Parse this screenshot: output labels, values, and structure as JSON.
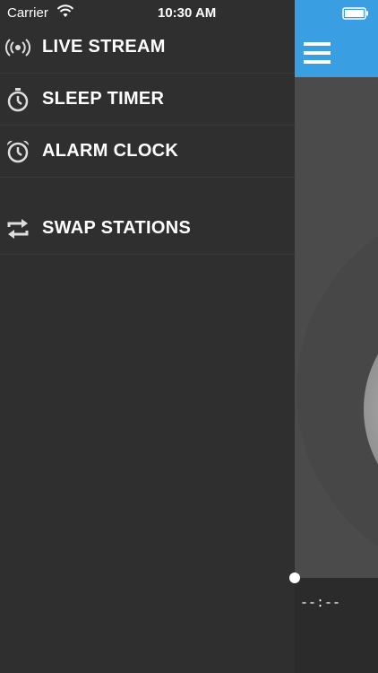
{
  "status_bar": {
    "carrier": "Carrier",
    "time": "10:30 AM"
  },
  "drawer": {
    "items": [
      {
        "label": "LIVE STREAM",
        "icon": "broadcast-icon"
      },
      {
        "label": "SLEEP TIMER",
        "icon": "stopwatch-icon"
      },
      {
        "label": "ALARM CLOCK",
        "icon": "alarm-clock-icon"
      },
      {
        "label": "SWAP STATIONS",
        "icon": "swap-icon"
      }
    ]
  },
  "player": {
    "elapsed": "--:--"
  },
  "colors": {
    "accent": "#3a9ee2",
    "drawer_bg": "#2f2f2f"
  }
}
